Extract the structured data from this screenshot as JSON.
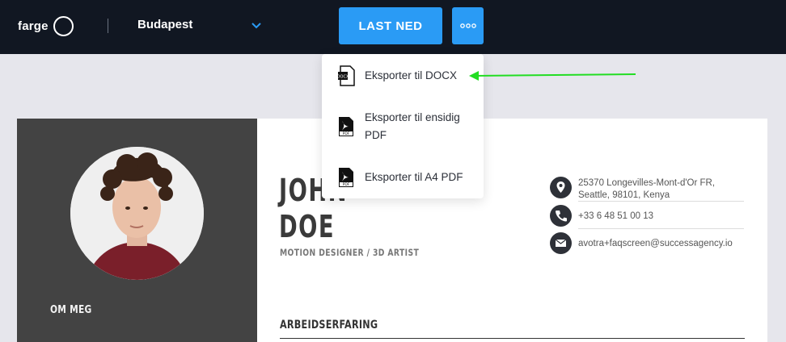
{
  "topbar": {
    "brand_label": "farge",
    "template_name": "Budapest",
    "download_label": "LAST NED"
  },
  "menu": {
    "items": [
      {
        "label": "Eksporter til DOCX",
        "icon": "docx-file-icon"
      },
      {
        "label_line1": "Eksporter til ensidig",
        "label_line2": "PDF",
        "icon": "pdf-file-icon"
      },
      {
        "label": "Eksporter til A4 PDF",
        "icon": "pdf-file-icon"
      }
    ]
  },
  "annotation": {
    "arrow_color": "#22dd22"
  },
  "resume": {
    "first_name": "JOHN",
    "last_name": "DOE",
    "job_title": "MOTION DESIGNER / 3D ARTIST",
    "about_label": "OM MEG",
    "experience_label": "ARBEIDSERFARING",
    "contact": {
      "address_line1": "25370 Longevilles-Mont-d'Or FR,",
      "address_line2": "Seattle, 98101, Kenya",
      "phone": "+33 6 48 51 00 13",
      "email": "avotra+faqscreen@successagency.io"
    }
  },
  "colors": {
    "topbar_bg": "#111722",
    "accent_blue": "#2a9bf5",
    "sidebar_bg": "#434343"
  }
}
